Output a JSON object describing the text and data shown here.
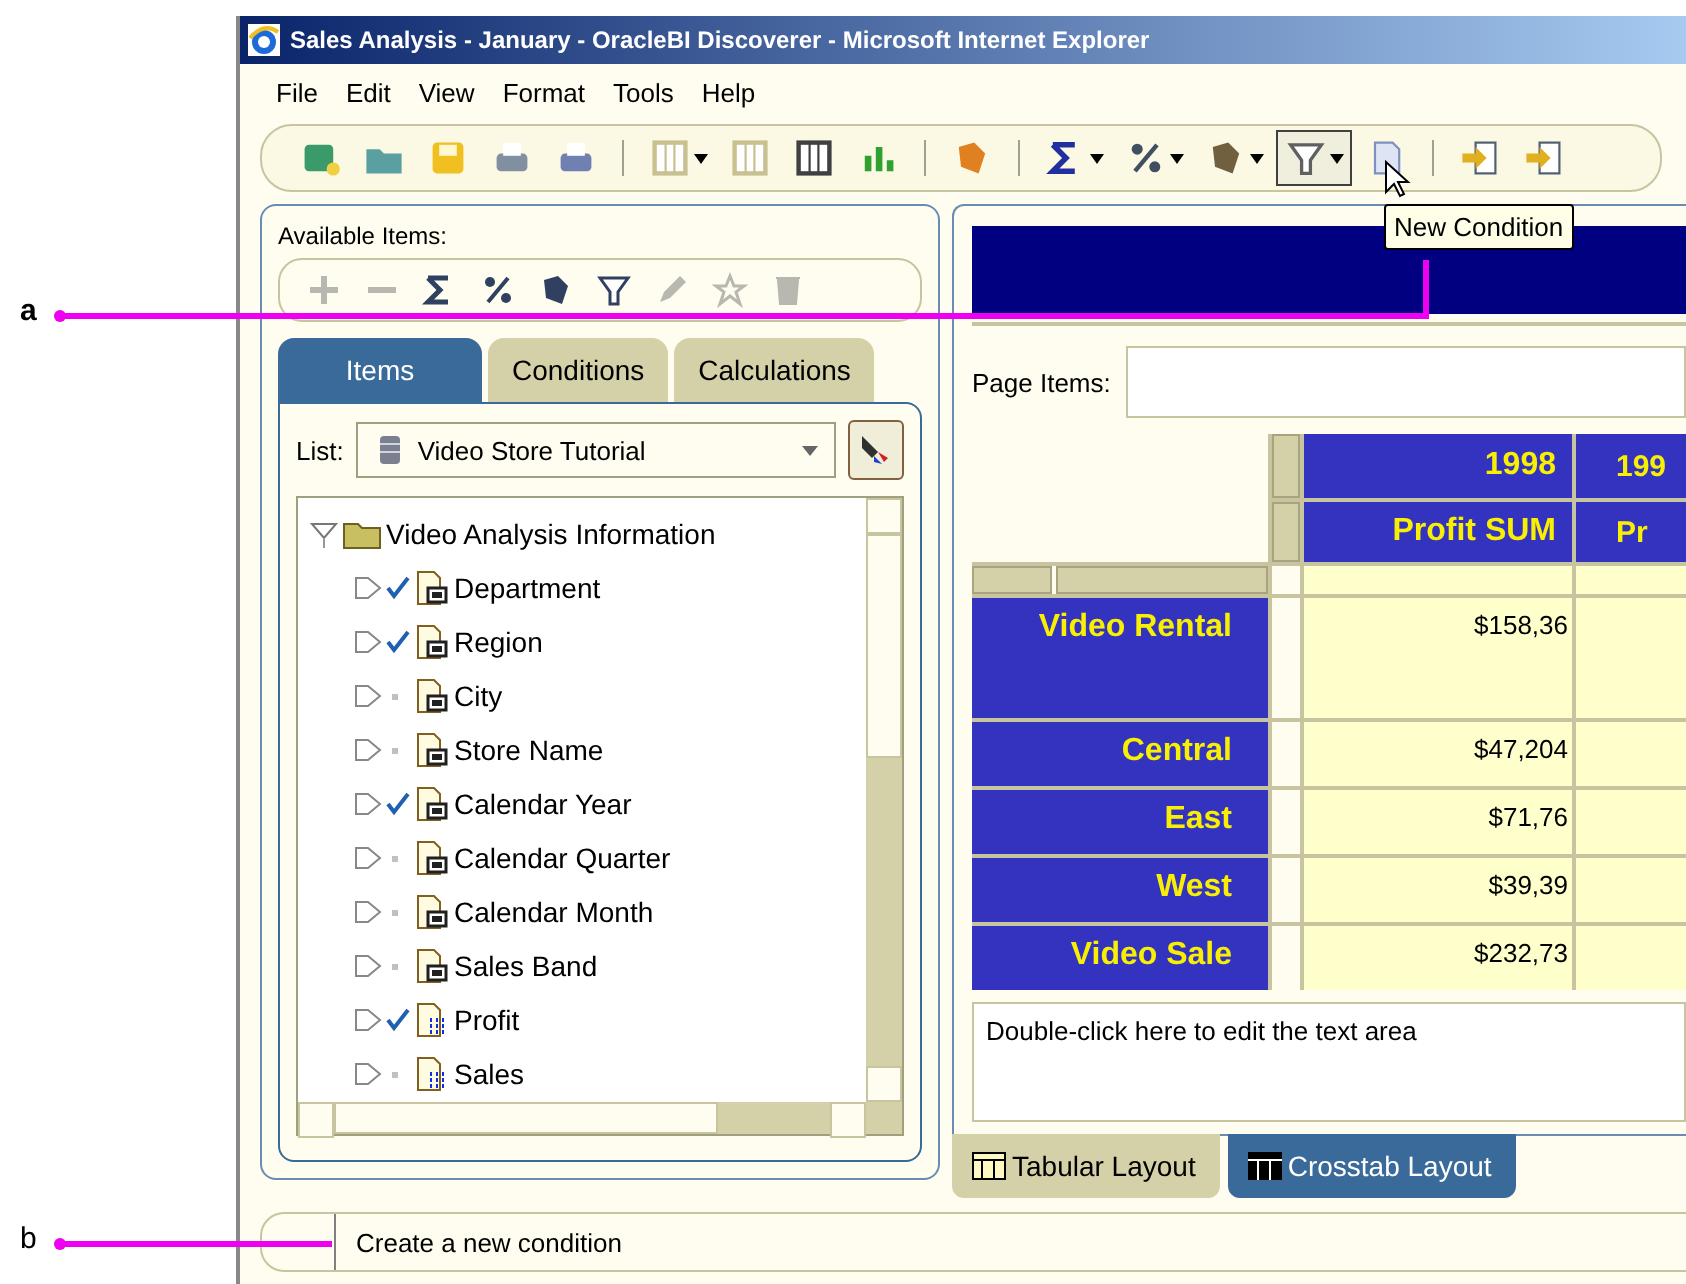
{
  "callouts": [
    {
      "label": "a"
    },
    {
      "label": "b"
    }
  ],
  "window": {
    "title": "Sales Analysis - January - OracleBI  Discoverer - Microsoft Internet Explorer"
  },
  "menu": [
    "File",
    "Edit",
    "View",
    "Format",
    "Tools",
    "Help"
  ],
  "tooltip": "New Condition",
  "available_items": {
    "label": "Available Items:"
  },
  "tabs": [
    {
      "label": "Items",
      "selected": true
    },
    {
      "label": "Conditions",
      "selected": false
    },
    {
      "label": "Calculations",
      "selected": false
    }
  ],
  "list": {
    "label": "List:",
    "value": "Video Store Tutorial"
  },
  "tree": {
    "label": "Video Analysis Information",
    "expanded": true,
    "children": [
      {
        "label": "Department",
        "checked": true,
        "kind": "dimension"
      },
      {
        "label": "Region",
        "checked": true,
        "kind": "dimension"
      },
      {
        "label": "City",
        "checked": false,
        "kind": "dimension"
      },
      {
        "label": "Store Name",
        "checked": false,
        "kind": "dimension"
      },
      {
        "label": "Calendar Year",
        "checked": true,
        "kind": "dimension"
      },
      {
        "label": "Calendar Quarter",
        "checked": false,
        "kind": "dimension"
      },
      {
        "label": "Calendar Month",
        "checked": false,
        "kind": "dimension"
      },
      {
        "label": "Sales Band",
        "checked": false,
        "kind": "dimension"
      },
      {
        "label": "Profit",
        "checked": true,
        "kind": "measure"
      },
      {
        "label": "Sales",
        "checked": false,
        "kind": "measure"
      }
    ]
  },
  "page_items": {
    "label": "Page Items:"
  },
  "crosstab": {
    "columns": [
      {
        "year": "1998",
        "measure": "Profit SUM"
      },
      {
        "year": "199",
        "measure": "Pr"
      }
    ],
    "rows": [
      {
        "label": "Video Rental",
        "value": "$158,36",
        "tall": true
      },
      {
        "label": "Central",
        "value": "$47,204",
        "tall": false
      },
      {
        "label": "East",
        "value": "$71,76",
        "tall": false
      },
      {
        "label": "West",
        "value": "$39,39",
        "tall": false
      },
      {
        "label": "Video Sale",
        "value": "$232,73",
        "tall": false
      }
    ]
  },
  "text_area": "Double-click here to edit the text area",
  "layout_tabs": [
    {
      "label": "Tabular Layout",
      "selected": false
    },
    {
      "label": "Crosstab Layout",
      "selected": true
    }
  ],
  "status_bar": "Create a new condition"
}
